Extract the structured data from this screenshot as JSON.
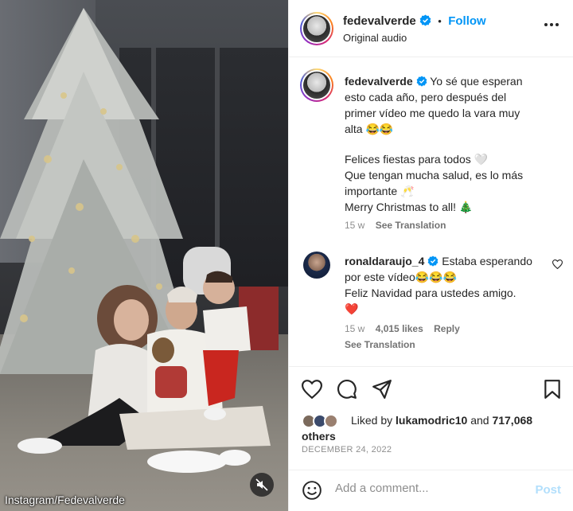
{
  "media": {
    "credit": "Instagram/Fedevalverde",
    "mute_icon": "speaker-muted-icon"
  },
  "header": {
    "username": "fedevalverde",
    "follow_label": "Follow",
    "separator": "•",
    "audio_label": "Original audio",
    "more_icon": "more-dots-icon"
  },
  "caption": {
    "username": "fedevalverde",
    "lines": [
      "Yo sé que esperan",
      "esto cada año, pero después del",
      "primer vídeo me quedo la vara muy",
      "alta 😂😂"
    ],
    "lines2": [
      "Felices fiestas para todos 🤍",
      "Que tengan mucha salud, es lo más",
      "importante 🥂",
      "Merry Christmas to all! 🎄"
    ],
    "age": "15 w",
    "see_translation": "See Translation"
  },
  "comment": {
    "username": "ronaldaraujo_4",
    "line1": "Estaba esperando",
    "line2": "por este vídeo😂😂😂",
    "line3": "Feliz Navidad para ustedes amigo.",
    "line4": "❤️",
    "age": "15 w",
    "likes": "4,015 likes",
    "reply": "Reply",
    "see_translation": "See Translation"
  },
  "likes": {
    "prefix": "Liked by",
    "user": "lukamodric10",
    "and": "and",
    "count": "717,068",
    "others": "others"
  },
  "date": "DECEMBER 24, 2022",
  "comment_box": {
    "placeholder": "Add a comment...",
    "post_label": "Post"
  },
  "colors": {
    "accent": "#0095f6",
    "verified": "#0095f6",
    "post_disabled": "#b2dffc",
    "muted_text": "#8e8e8e"
  }
}
